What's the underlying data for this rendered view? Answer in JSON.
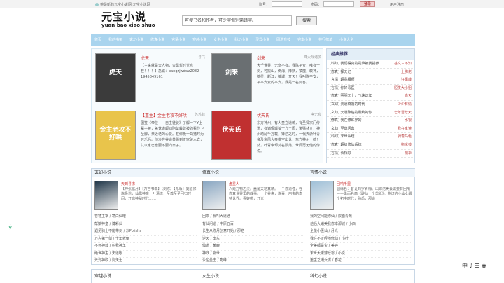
{
  "topbar": {
    "favorite": "将最新的元宝小说网|元宝小说网",
    "account_label": "账号：",
    "password_label": "密码：",
    "login_button": "登录",
    "register": "用户注册"
  },
  "logo": {
    "cn": "元宝小说",
    "pinyin": "yuan bao xiao shuo"
  },
  "search": {
    "placeholder": "可搜书名和作者，可少字但别输错字。",
    "button": "搜索"
  },
  "nav": [
    "首页",
    "我的书架",
    "玄幻小说",
    "修真小说",
    "言情小说",
    "穿越小说",
    "女生小说",
    "科幻小说",
    "灵异小说",
    "网游竞技",
    "完本小说",
    "排行榜单",
    "小说大全"
  ],
  "featured": [
    {
      "title": "虎天",
      "author": "寻飞",
      "cover_text": "虎天",
      "cover_color": "#3b3b3b",
      "desc": "【主来就是大人物，只需暂时觉点茬！！！】急需：panqzjwdwz2082 1945849161"
    },
    {
      "title": "剑来",
      "author": "烽火戏诸侯",
      "cover_text": "剑来",
      "cover_color": "#6a6f72",
      "desc": "大千世界，无奇不有。我陈平安，唯有一剑，可搬山，倒海，降妖，镇魔，敕神，摘星，断江，摧城，开天！我叫陈平安，平平安安的平安，我是一名剑客。"
    },
    {
      "title": "【重生】金主老攻不好哄",
      "author": "苏苏菲",
      "cover_text": "金主老攻不好哄",
      "cover_color": "#e9c44b",
      "desc": "国签《帝位——自主徒徒》了解一下Y上辈子被，盖世道颤四阿莫藏建被的看作卫至脚，亲近老的心爱。趁你晚一曲猪时为只乐后。他沙在谷道黄弹到正家破人亡，艾以家已也要不要向日子。"
    },
    {
      "title": "伏天氏",
      "author": "净无痕",
      "cover_text": "伏天氏",
      "cover_color": "#c03030",
      "desc": "东方神州，有人皇立道统，有圣贤宗门传道，有诸侯城镇一方王国，诸强林立，神州动乱千万载，锋达之时，一代天骄叶青帝及东凰大帝横空出世，东方神州一统！然，叶青帝却莫名陨落，世间再无他的传说。"
    }
  ],
  "sidebar": {
    "title": "经典推荐",
    "rows": [
      {
        "t": "[科幻] 我们得真的是谁被我捐养",
        "a": "甚文三不知"
      },
      {
        "t": "[修真] 择天记",
        "a": "土佛佬"
      },
      {
        "t": "[言情] 超品相师",
        "a": "狂鹰哉"
      },
      {
        "t": "[言情] 你好毒医",
        "a": "短发大小姐"
      },
      {
        "t": "[修真] 明明天上，飞速这年",
        "a": "白天"
      },
      {
        "t": "[玄幻] 天道衰落的时代",
        "a": "少少有情"
      },
      {
        "t": "[玄幻] 天道降临的最终的你",
        "a": "七年雪七天"
      },
      {
        "t": "[修真] 我在修炼界的",
        "a": "水银"
      },
      {
        "t": "[玄幻] 至尊问鼎",
        "a": "我在家读"
      },
      {
        "t": "[科幻] 末世系统",
        "a": "骑着乌龟"
      },
      {
        "t": "[修真] 超级修仙系统",
        "a": "拖米孩"
      },
      {
        "t": "[言情] 长相思",
        "a": "桐华"
      }
    ]
  },
  "panels": [
    {
      "title": "玄幻小说",
      "book": "天到寻求",
      "desc": "【伸张弦月】【万古书单】【剑修】【无垢】剑道修炼极途，仙露神泉一叶清流，至尊至圣回归时间，开启神秘时代……",
      "img_color": "#22384a",
      "list": [
        "苍穹主宰 / 寒白仙眼",
        "帮嫡神皇 / 博彩仙",
        "遇见骑士不能带剑 / 沙Polisha",
        "万古第一剑 / 千年老龟",
        "不死神尊 / 叫我神羊",
        "绝世神主 / 天道眼",
        "光元神纹 / 剑天士"
      ]
    },
    {
      "title": "修真小说",
      "book": "盘星人",
      "desc": "人是万物之灵。盖是天地真精。一个修道者，在修真世界里的故事。一个养蛊，炼毒，用虫的奇特世界。看好啦，开光",
      "img_color": "#8aa7c2",
      "list": [
        "回来 / 我叫大道通",
        "背仙问道 / 中原五百",
        "长生从修月创意开始 / 那老",
        "逆天 / 李东",
        "仙道 / 某鹿",
        "神妖 / 斩世",
        "永恒圣王 / 秀峰"
      ]
    },
    {
      "title": "言情小说",
      "book": "回响千里",
      "desc": "圆缘名：昔让的罗青梅。出嫁倍美会需要有回响——勇而名高《醉仙一个剪纸》。金订的小仙女醒个初中时代，熟悉，那道",
      "img_color": "#a0c0d8",
      "list": [
        "我的空间能修仙 / 双面青苑",
        "他后大诸美我修本那城 / 小西",
        "全能小医仙 / 月光",
        "我在不正经地修仙 / 小叶",
        "全美都是宝 / 美婷",
        "末世大佬穿七零 / 小说",
        "重生之嫡女谋 / 春花"
      ]
    }
  ],
  "bottom": [
    "穿越小说",
    "女生小说",
    "科幻小说"
  ],
  "floating": "中 ♪ ☰ ♚"
}
